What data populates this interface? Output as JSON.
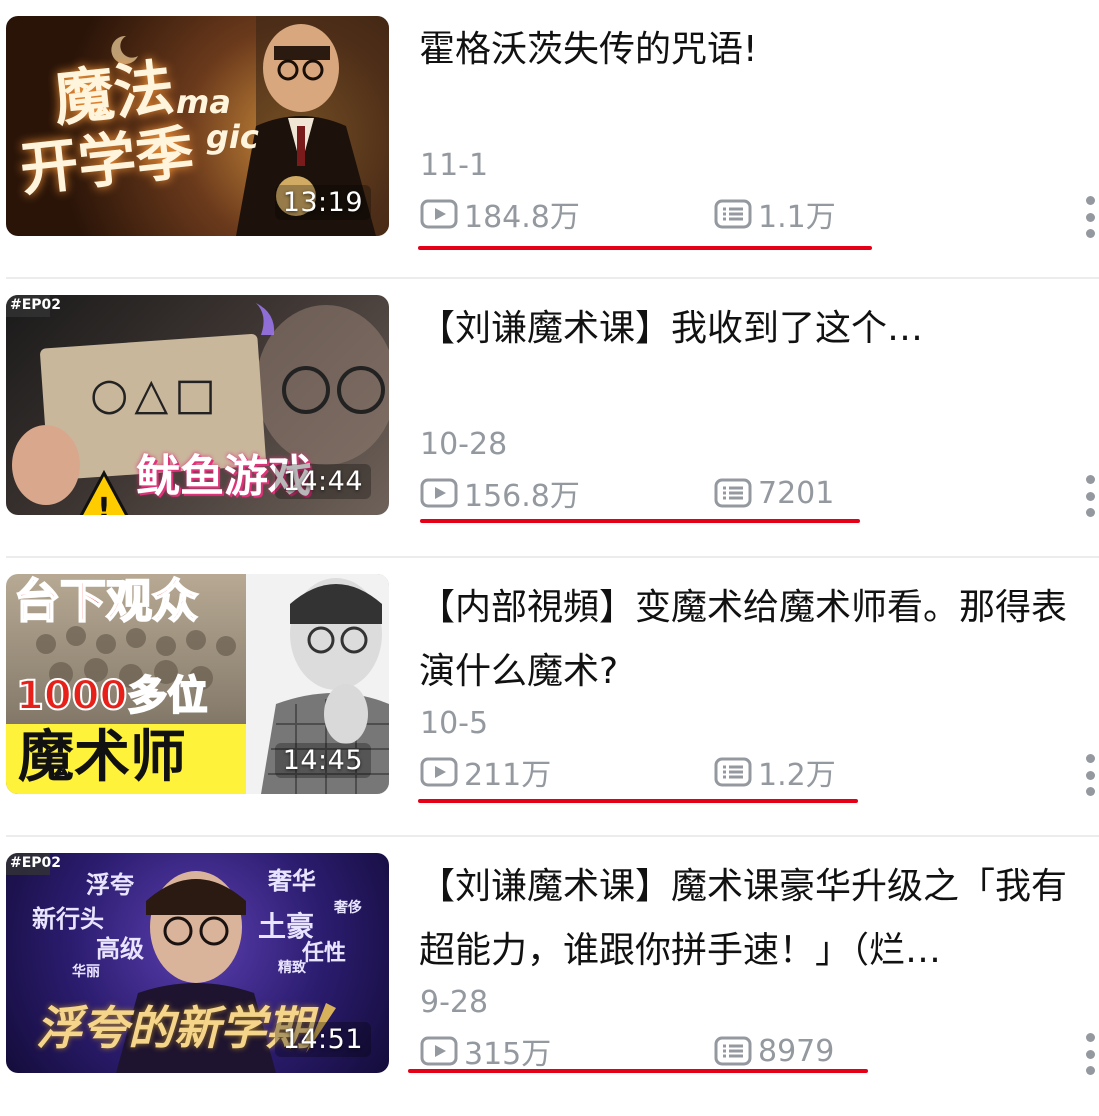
{
  "videos": [
    {
      "title": "霍格沃茨失传的咒语!",
      "duration": "13:19",
      "date": "11-1",
      "views": "184.8万",
      "comments": "1.1万",
      "thumb_text": [
        "魔法",
        "开学季",
        "ma",
        "gic"
      ]
    },
    {
      "title": "【刘谦魔术课】我收到了这个…",
      "duration": "14:44",
      "date": "10-28",
      "views": "156.8万",
      "comments": "7201",
      "thumb_text": [
        "#EP02",
        "○△□",
        "鱿鱼游戏"
      ]
    },
    {
      "title": "【内部視頻】变魔术给魔术师看。那得表演什么魔术?",
      "duration": "14:45",
      "date": "10-5",
      "views": "211万",
      "comments": "1.2万",
      "thumb_text": [
        "台下观众",
        "1000多位",
        "魔术师"
      ]
    },
    {
      "title": "【刘谦魔术课】魔术课豪华升级之「我有超能力，谁跟你拼手速！」（烂…",
      "duration": "14:51",
      "date": "9-28",
      "views": "315万",
      "comments": "8979",
      "thumb_text": [
        "#EP02",
        "浮夸",
        "奢华",
        "新行头",
        "奢侈",
        "土豪",
        "高级",
        "任性",
        "华丽",
        "精致",
        "浮夸的新学期"
      ]
    }
  ],
  "icons": {
    "views": "play-count-icon",
    "comments": "danmaku-count-icon",
    "more": "more-vertical-icon"
  },
  "colors": {
    "underline": "#e50017",
    "meta_text": "#9499a0",
    "title_text": "#111111"
  }
}
